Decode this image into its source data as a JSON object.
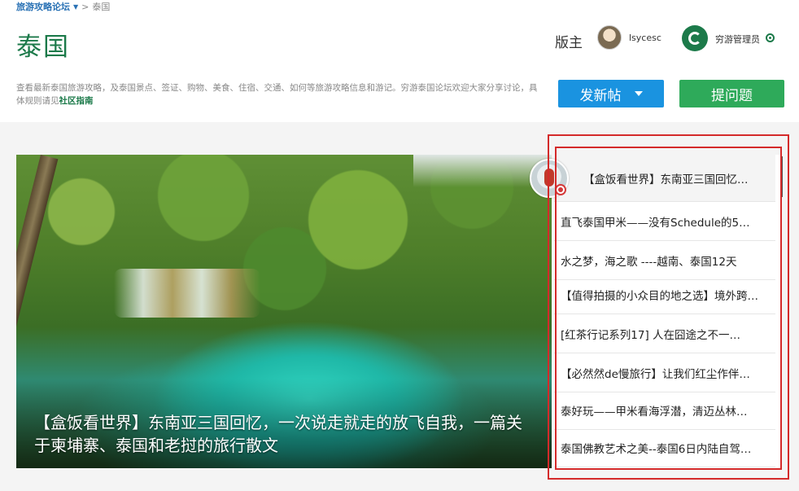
{
  "breadcrumb": {
    "forum": "旅游攻略论坛",
    "separator": ">",
    "current": "泰国"
  },
  "page_title": "泰国",
  "description": {
    "text": "查看最新泰国旅游攻略，及泰国景点、签证、购物、美食、住宿、交通、如何等旅游攻略信息和游记。穷游泰国论坛欢迎大家分享讨论，具体规则请见",
    "guide_link": "社区指南"
  },
  "moderator": {
    "label": "版主",
    "name": "lsycesc",
    "admin_name": "穷游管理员"
  },
  "buttons": {
    "new_post": "发新帖",
    "ask_question": "提问题"
  },
  "featured": {
    "title": "【盒饭看世界】东南亚三国回忆，一次说走就走的放飞自我，一篇关于柬埔寨、泰国和老挝的旅行散文"
  },
  "thread_list": [
    "【盒饭看世界】东南亚三国回忆…",
    "直飞泰国甲米——没有Schedule的5…",
    "水之梦，海之歌 ----越南、泰国12天",
    "【值得拍摄的小众目的地之选】境外跨…",
    "[红茶行记系列17] 人在囧途之不一…",
    "【必然然de慢旅行】让我们红尘作伴…",
    "泰好玩——甲米看海浮潜，清迈丛林…",
    "泰国佛教艺术之美--泰国6日内陆自驾…"
  ],
  "colors": {
    "title_green": "#1c7a4a",
    "post_blue": "#1a93e0",
    "ask_green": "#2eaa5a",
    "highlight_red": "#d42a2a"
  }
}
